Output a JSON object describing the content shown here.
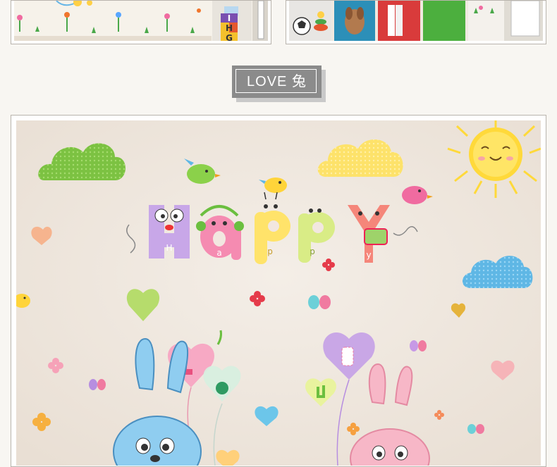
{
  "title_badge": {
    "text": "LOVE 兔"
  },
  "word_art": {
    "letters": [
      "H",
      "a",
      "p",
      "p",
      "y"
    ]
  },
  "thumb_left": {
    "letters": [
      "I",
      "H",
      "G"
    ]
  },
  "colors": {
    "cloud_green": "#7cc242",
    "cloud_yellow": "#fde26a",
    "cloud_blue": "#5fb7e5",
    "sun": "#ffd93a",
    "badge_gray": "#8b8b8b",
    "rabbit_blue": "#8fcdf0",
    "rabbit_pink": "#f7b7c7"
  }
}
